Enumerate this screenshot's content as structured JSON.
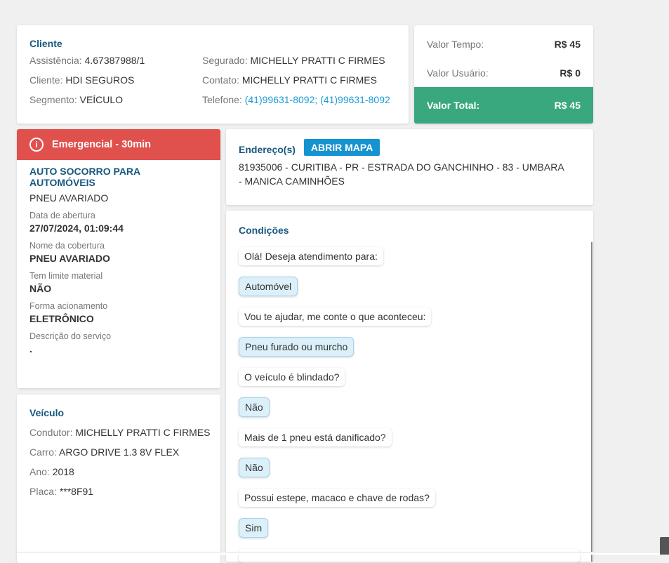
{
  "cliente": {
    "title": "Cliente",
    "left": [
      {
        "label": "Assistência:",
        "value": "4.67387988/1"
      },
      {
        "label": "Cliente:",
        "value": "HDI SEGUROS"
      },
      {
        "label": "Segmento:",
        "value": "VEÍCULO"
      }
    ],
    "segurado": {
      "label": "Segurado:",
      "value": "MICHELLY PRATTI C FIRMES"
    },
    "contato": {
      "label": "Contato:",
      "value": "MICHELLY PRATTI C FIRMES"
    },
    "telefone": {
      "label": "Telefone:",
      "value": "(41)99631-8092; (41)99631-8092"
    }
  },
  "valores": {
    "tempo": {
      "label": "Valor Tempo:",
      "value": "R$ 45"
    },
    "usuario": {
      "label": "Valor Usuário:",
      "value": "R$ 0"
    },
    "total": {
      "label": "Valor Total:",
      "value": "R$ 45"
    },
    "total_color": "#3aa87e"
  },
  "servico": {
    "badge": "Emergencial - 30min",
    "badge_color": "#e0504d",
    "title": "AUTO SOCORRO PARA AUTOMÓVEIS",
    "subtitle": "PNEU AVARIADO",
    "fields": [
      {
        "label": "Data de abertura",
        "value": "27/07/2024, 01:09:44"
      },
      {
        "label": "Nome da cobertura",
        "value": "PNEU AVARIADO"
      },
      {
        "label": "Tem limite material",
        "value": "NÃO"
      },
      {
        "label": "Forma acionamento",
        "value": "ELETRÔNICO"
      },
      {
        "label": "Descrição do serviço",
        "value": "."
      }
    ]
  },
  "veiculo": {
    "title": "Veículo",
    "rows": [
      {
        "label": "Condutor:",
        "value": "MICHELLY PRATTI C FIRMES"
      },
      {
        "label": "Carro:",
        "value": "ARGO DRIVE 1.3 8V FLEX"
      },
      {
        "label": "Ano:",
        "value": "2018"
      },
      {
        "label": "Placa:",
        "value": "***8F91"
      }
    ]
  },
  "endereco": {
    "title": "Endereço(s)",
    "button": "ABRIR MAPA",
    "address": "81935006 - CURITIBA - PR - ESTRADA DO GANCHINHO - 83 - UMBARA - MANICA CAMINHÕES"
  },
  "condicoes": {
    "title": "Condições",
    "messages": [
      {
        "text": "Olá! Deseja atendimento para:",
        "answer": false
      },
      {
        "text": "Automóvel",
        "answer": true
      },
      {
        "text": "Vou te ajudar, me conte o que aconteceu:",
        "answer": false
      },
      {
        "text": "Pneu furado ou murcho",
        "answer": true
      },
      {
        "text": "O veículo é blindado?",
        "answer": false
      },
      {
        "text": "Não",
        "answer": true
      },
      {
        "text": "Mais de 1 pneu está danificado?",
        "answer": false
      },
      {
        "text": "Não",
        "answer": true
      },
      {
        "text": "Possui estepe, macaco e chave de rodas?",
        "answer": false
      },
      {
        "text": "Sim",
        "answer": true
      }
    ]
  }
}
